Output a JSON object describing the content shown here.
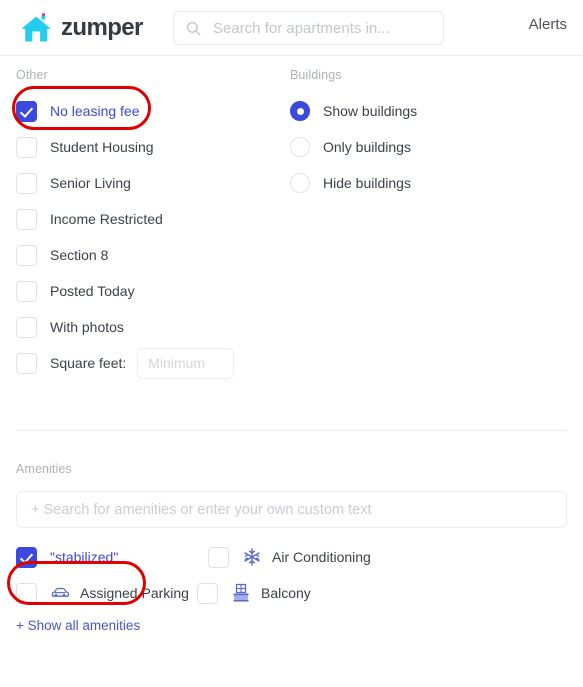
{
  "header": {
    "logo_text": "zumper",
    "logo_icon": "house-heart-logo",
    "search_icon": "search-icon",
    "search_placeholder": "Search for apartments in...",
    "search_value": "",
    "alerts_label": "Alerts"
  },
  "colors": {
    "accent": "#3b49df",
    "logo_house": "#22cdf0",
    "logo_heart": "#e3197f",
    "annotation": "#e00000",
    "icon_blue": "#5b6ad0",
    "text": "#3c4149",
    "muted": "#aeb2b7"
  },
  "other": {
    "label": "Other",
    "items": [
      {
        "label": "No leasing fee",
        "checked": true,
        "highlighted": true
      },
      {
        "label": "Student Housing",
        "checked": false,
        "highlighted": false
      },
      {
        "label": "Senior Living",
        "checked": false,
        "highlighted": false
      },
      {
        "label": "Income Restricted",
        "checked": false,
        "highlighted": false
      },
      {
        "label": "Section 8",
        "checked": false,
        "highlighted": false
      },
      {
        "label": "Posted Today",
        "checked": false,
        "highlighted": false
      },
      {
        "label": "With photos",
        "checked": false,
        "highlighted": false
      }
    ],
    "square_feet": {
      "label": "Square feet:",
      "checked": false,
      "input_placeholder": "Minimum",
      "input_value": ""
    }
  },
  "buildings": {
    "label": "Buildings",
    "options": [
      {
        "label": "Show buildings",
        "selected": true
      },
      {
        "label": "Only buildings",
        "selected": false
      },
      {
        "label": "Hide buildings",
        "selected": false
      }
    ]
  },
  "amenities": {
    "label": "Amenities",
    "search_placeholder": "+ Search for amenities or enter your own custom text",
    "search_value": "",
    "items": [
      {
        "label": "\"stabilized\"",
        "checked": true,
        "icon": null,
        "highlighted": true
      },
      {
        "label": "Air Conditioning",
        "checked": false,
        "icon": "snowflake-icon",
        "highlighted": false
      },
      {
        "label": "Assigned Parking",
        "checked": false,
        "icon": "car-icon",
        "highlighted": false
      },
      {
        "label": "Balcony",
        "checked": false,
        "icon": "balcony-icon",
        "highlighted": false
      }
    ],
    "show_all_label": "+ Show all amenities"
  }
}
